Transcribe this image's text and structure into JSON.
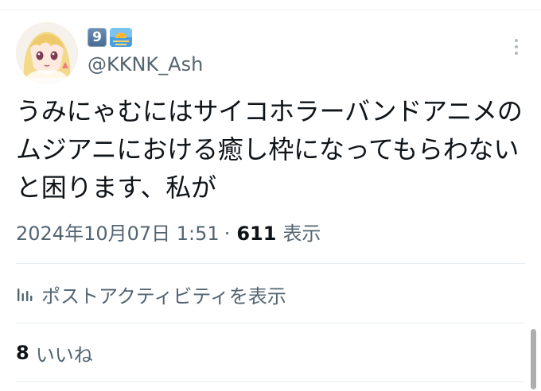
{
  "tweet": {
    "emoji_badge": "9",
    "emoji_sunrise_icon": "sunrise-emoji-icon",
    "handle": "@KKNK_Ash",
    "text": "うみにゃむにはサイコホラーバンドアニメの\nムジアニにおける癒し枠になってもらわない\nと困ります、私が",
    "timestamp": "2024年10月07日 1:51",
    "separator": "·",
    "views_count": "611",
    "views_label": "表示",
    "activity_label": "ポストアクティビティを表示",
    "likes_count": "8",
    "likes_label": "いいね"
  },
  "icons": {
    "more": "more-vertical-icon",
    "activity": "analytics-bars-icon",
    "avatar": "avatar-illustration"
  },
  "colors": {
    "text_primary": "#0f1419",
    "text_secondary": "#536471",
    "divider": "#e6ecf0",
    "emoji_badge_blue": "#5a7ea6"
  }
}
